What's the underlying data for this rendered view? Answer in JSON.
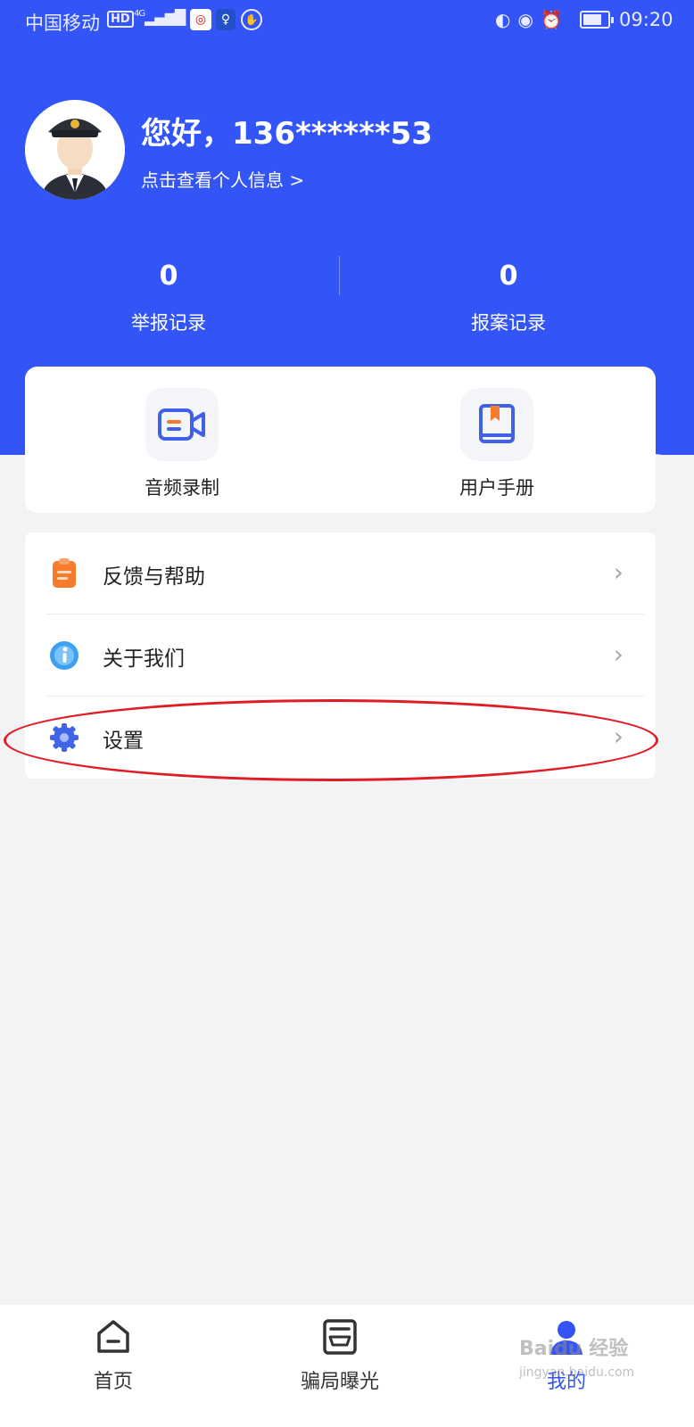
{
  "status_bar": {
    "carrier": "中国移动",
    "hd": "HD",
    "network": "4G",
    "time": "09:20"
  },
  "profile": {
    "greeting": "您好，136******53",
    "view_info_link": "点击查看个人信息 >"
  },
  "stats": [
    {
      "value": "0",
      "label": "举报记录"
    },
    {
      "value": "0",
      "label": "报案记录"
    }
  ],
  "quick_actions": [
    {
      "label": "音频录制",
      "icon": "video-camera-icon"
    },
    {
      "label": "用户手册",
      "icon": "book-icon"
    }
  ],
  "menu": [
    {
      "label": "反馈与帮助",
      "icon": "clipboard-icon"
    },
    {
      "label": "关于我们",
      "icon": "info-icon"
    },
    {
      "label": "设置",
      "icon": "gear-icon"
    }
  ],
  "tabbar": [
    {
      "label": "首页",
      "icon": "home-icon"
    },
    {
      "label": "骗局曝光",
      "icon": "exposure-icon"
    },
    {
      "label": "我的",
      "icon": "profile-icon",
      "active": true
    }
  ],
  "watermark": {
    "line1": "Baidu 经验",
    "line2": "jingyan.baidu.com"
  },
  "colors": {
    "brand_blue": "#3355f7",
    "background": "#f3f3f5",
    "accent_orange": "#f47c2c",
    "highlight_red": "#e01c24"
  }
}
